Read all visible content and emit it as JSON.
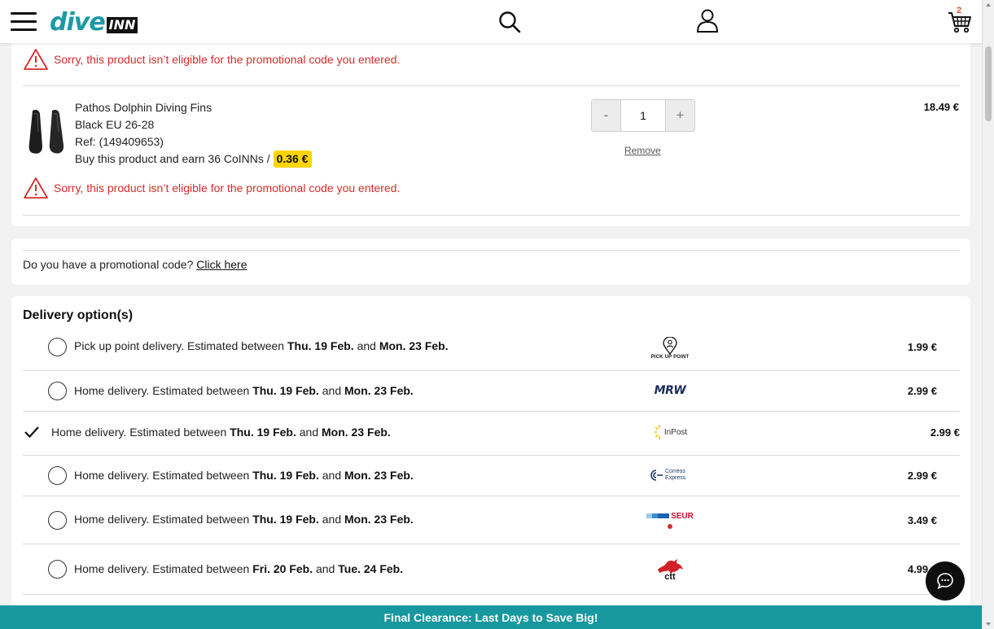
{
  "header": {
    "logo_dive": "dive",
    "logo_inn": "INN",
    "cart_count": "2"
  },
  "colors": {
    "brand": "#1a9aa8",
    "warning": "#d92b2b",
    "coin_badge": "#ffd400",
    "banner": "#17989f"
  },
  "cart": {
    "top_warning": "Sorry, this product isn’t eligible for the promotional code you entered.",
    "item": {
      "name": "Pathos Dolphin Diving Fins",
      "variant": "Black EU 26-28",
      "ref": "Ref: (149409653)",
      "earn_text": "Buy this product and earn 36 CoINNs /",
      "coin_value": "0.36 €",
      "qty_minus": "-",
      "quantity": "1",
      "qty_plus": "+",
      "remove_label": "Remove",
      "price": "18.49 €",
      "warning": "Sorry, this product isn’t eligible for the promotional code you entered."
    }
  },
  "promo": {
    "question": "Do you have a promotional code?",
    "link": "Click here"
  },
  "delivery": {
    "title": "Delivery option(s)",
    "options": [
      {
        "type": "Pick up point delivery. Estimated between",
        "from": "Thu. 19 Feb.",
        "and": "and",
        "to": "Mon. 23 Feb.",
        "carrier": "PICK UP POINT",
        "carrier_icon": "pickup-point-icon",
        "price": "1.99 €",
        "selected": false
      },
      {
        "type": "Home delivery. Estimated between",
        "from": "Thu. 19 Feb.",
        "and": "and",
        "to": "Mon. 23 Feb.",
        "carrier": "MRW",
        "carrier_icon": "mrw-logo",
        "price": "2.99 €",
        "selected": false
      },
      {
        "type": "Home delivery. Estimated between",
        "from": "Thu. 19 Feb.",
        "and": "and",
        "to": "Mon. 23 Feb.",
        "carrier": "InPost",
        "carrier_icon": "inpost-logo",
        "price": "2.99 €",
        "selected": true
      },
      {
        "type": "Home delivery. Estimated between",
        "from": "Thu. 19 Feb.",
        "and": "and",
        "to": "Mon. 23 Feb.",
        "carrier": "Correos Express",
        "carrier_icon": "correos-express-logo",
        "price": "2.99 €",
        "selected": false
      },
      {
        "type": "Home delivery. Estimated between",
        "from": "Thu. 19 Feb.",
        "and": "and",
        "to": "Mon. 23 Feb.",
        "carrier": "SEUR",
        "carrier_icon": "seur-logo",
        "price": "3.49 €",
        "selected": false
      },
      {
        "type": "Home delivery. Estimated between",
        "from": "Fri. 20 Feb.",
        "and": "and",
        "to": "Tue. 24 Feb.",
        "carrier": "ctt",
        "carrier_icon": "ctt-logo",
        "price": "4.99 €",
        "selected": false
      }
    ]
  },
  "banner": {
    "text": "Final Clearance: Last Days to Save Big!"
  }
}
